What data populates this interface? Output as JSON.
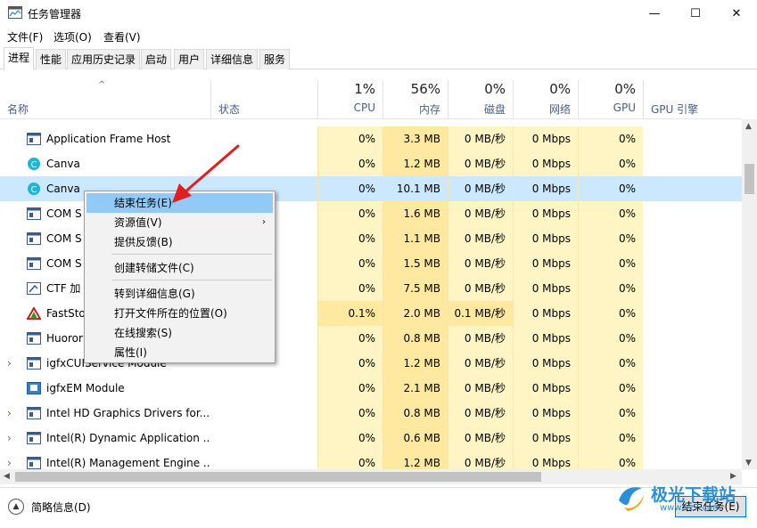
{
  "window": {
    "title": "任务管理器",
    "controls": {
      "minimize": "—",
      "maximize": "☐",
      "close": "✕"
    }
  },
  "menu": [
    "文件(F)",
    "选项(O)",
    "查看(V)"
  ],
  "tabs": [
    "进程",
    "性能",
    "应用历史记录",
    "启动",
    "用户",
    "详细信息",
    "服务"
  ],
  "columns": {
    "name": "名称",
    "status": "状态",
    "cpu": {
      "pct": "1%",
      "label": "CPU"
    },
    "memory": {
      "pct": "56%",
      "label": "内存"
    },
    "disk": {
      "pct": "0%",
      "label": "磁盘"
    },
    "network": {
      "pct": "0%",
      "label": "网络"
    },
    "gpu": {
      "pct": "0%",
      "label": "GPU"
    },
    "gpu_engine": "GPU 引擎"
  },
  "processes": [
    {
      "name": "Application Frame Host",
      "cpu": "0%",
      "mem": "3.3 MB",
      "disk": "0 MB/秒",
      "net": "0 Mbps",
      "gpu": "0%",
      "expand": false,
      "icon": "app-frame-icon"
    },
    {
      "name": "Canva",
      "cpu": "0%",
      "mem": "1.2 MB",
      "disk": "0 MB/秒",
      "net": "0 Mbps",
      "gpu": "0%",
      "expand": false,
      "icon": "canva-icon"
    },
    {
      "name": "Canva",
      "cpu": "0%",
      "mem": "10.1 MB",
      "disk": "0 MB/秒",
      "net": "0 Mbps",
      "gpu": "0%",
      "expand": false,
      "icon": "canva-icon"
    },
    {
      "name": "COM S",
      "cpu": "0%",
      "mem": "1.6 MB",
      "disk": "0 MB/秒",
      "net": "0 Mbps",
      "gpu": "0%",
      "expand": false,
      "icon": "com-icon"
    },
    {
      "name": "COM S",
      "cpu": "0%",
      "mem": "1.1 MB",
      "disk": "0 MB/秒",
      "net": "0 Mbps",
      "gpu": "0%",
      "expand": false,
      "icon": "com-icon"
    },
    {
      "name": "COM S",
      "cpu": "0%",
      "mem": "1.5 MB",
      "disk": "0 MB/秒",
      "net": "0 Mbps",
      "gpu": "0%",
      "expand": false,
      "icon": "com-icon"
    },
    {
      "name": "CTF 加",
      "cpu": "0%",
      "mem": "7.5 MB",
      "disk": "0 MB/秒",
      "net": "0 Mbps",
      "gpu": "0%",
      "expand": false,
      "icon": "ctf-icon"
    },
    {
      "name": "FastSto",
      "cpu": "0.1%",
      "mem": "2.0 MB",
      "disk": "0.1 MB/秒",
      "net": "0 Mbps",
      "gpu": "0%",
      "expand": false,
      "icon": "faststone-icon"
    },
    {
      "name": "Huoror",
      "cpu": "0%",
      "mem": "0.8 MB",
      "disk": "0 MB/秒",
      "net": "0 Mbps",
      "gpu": "0%",
      "expand": false,
      "icon": "app-icon"
    },
    {
      "name": "igfxCUIService Module",
      "cpu": "0%",
      "mem": "1.2 MB",
      "disk": "0 MB/秒",
      "net": "0 Mbps",
      "gpu": "0%",
      "expand": true,
      "icon": "app-icon"
    },
    {
      "name": "igfxEM Module",
      "cpu": "0%",
      "mem": "2.1 MB",
      "disk": "0 MB/秒",
      "net": "0 Mbps",
      "gpu": "0%",
      "expand": false,
      "icon": "igfx-icon"
    },
    {
      "name": "Intel HD Graphics Drivers for...",
      "cpu": "0%",
      "mem": "0.8 MB",
      "disk": "0 MB/秒",
      "net": "0 Mbps",
      "gpu": "0%",
      "expand": true,
      "icon": "app-icon"
    },
    {
      "name": "Intel(R) Dynamic Application ...",
      "cpu": "0%",
      "mem": "0.6 MB",
      "disk": "0 MB/秒",
      "net": "0 Mbps",
      "gpu": "0%",
      "expand": true,
      "icon": "app-icon"
    },
    {
      "name": "Intel(R) Management Engine ...",
      "cpu": "0%",
      "mem": "1.2 MB",
      "disk": "0 MB/秒",
      "net": "0 Mbps",
      "gpu": "0%",
      "expand": true,
      "icon": "app-icon"
    }
  ],
  "context_menu": [
    {
      "label": "结束任务(E)",
      "highlight": true,
      "submenu": false
    },
    {
      "label": "资源值(V)",
      "highlight": false,
      "submenu": true
    },
    {
      "label": "提供反馈(B)",
      "highlight": false,
      "submenu": false
    },
    {
      "label": "创建转储文件(C)",
      "highlight": false,
      "submenu": false
    },
    {
      "label": "转到详细信息(G)",
      "highlight": false,
      "submenu": false
    },
    {
      "label": "打开文件所在的位置(O)",
      "highlight": false,
      "submenu": false
    },
    {
      "label": "在线搜索(S)",
      "highlight": false,
      "submenu": false
    },
    {
      "label": "属性(I)",
      "highlight": false,
      "submenu": false
    }
  ],
  "footer": {
    "fewer_details": "简略信息(D)",
    "end_task": "结束任务(E)"
  },
  "watermark": {
    "line1": "极光下载站",
    "line2": "www.xz7.com"
  },
  "colors": {
    "usage_light": "#fff4c4",
    "usage_mid": "#ffe8a0",
    "selected_row": "#cce8ff",
    "arrow": "#e02020"
  }
}
